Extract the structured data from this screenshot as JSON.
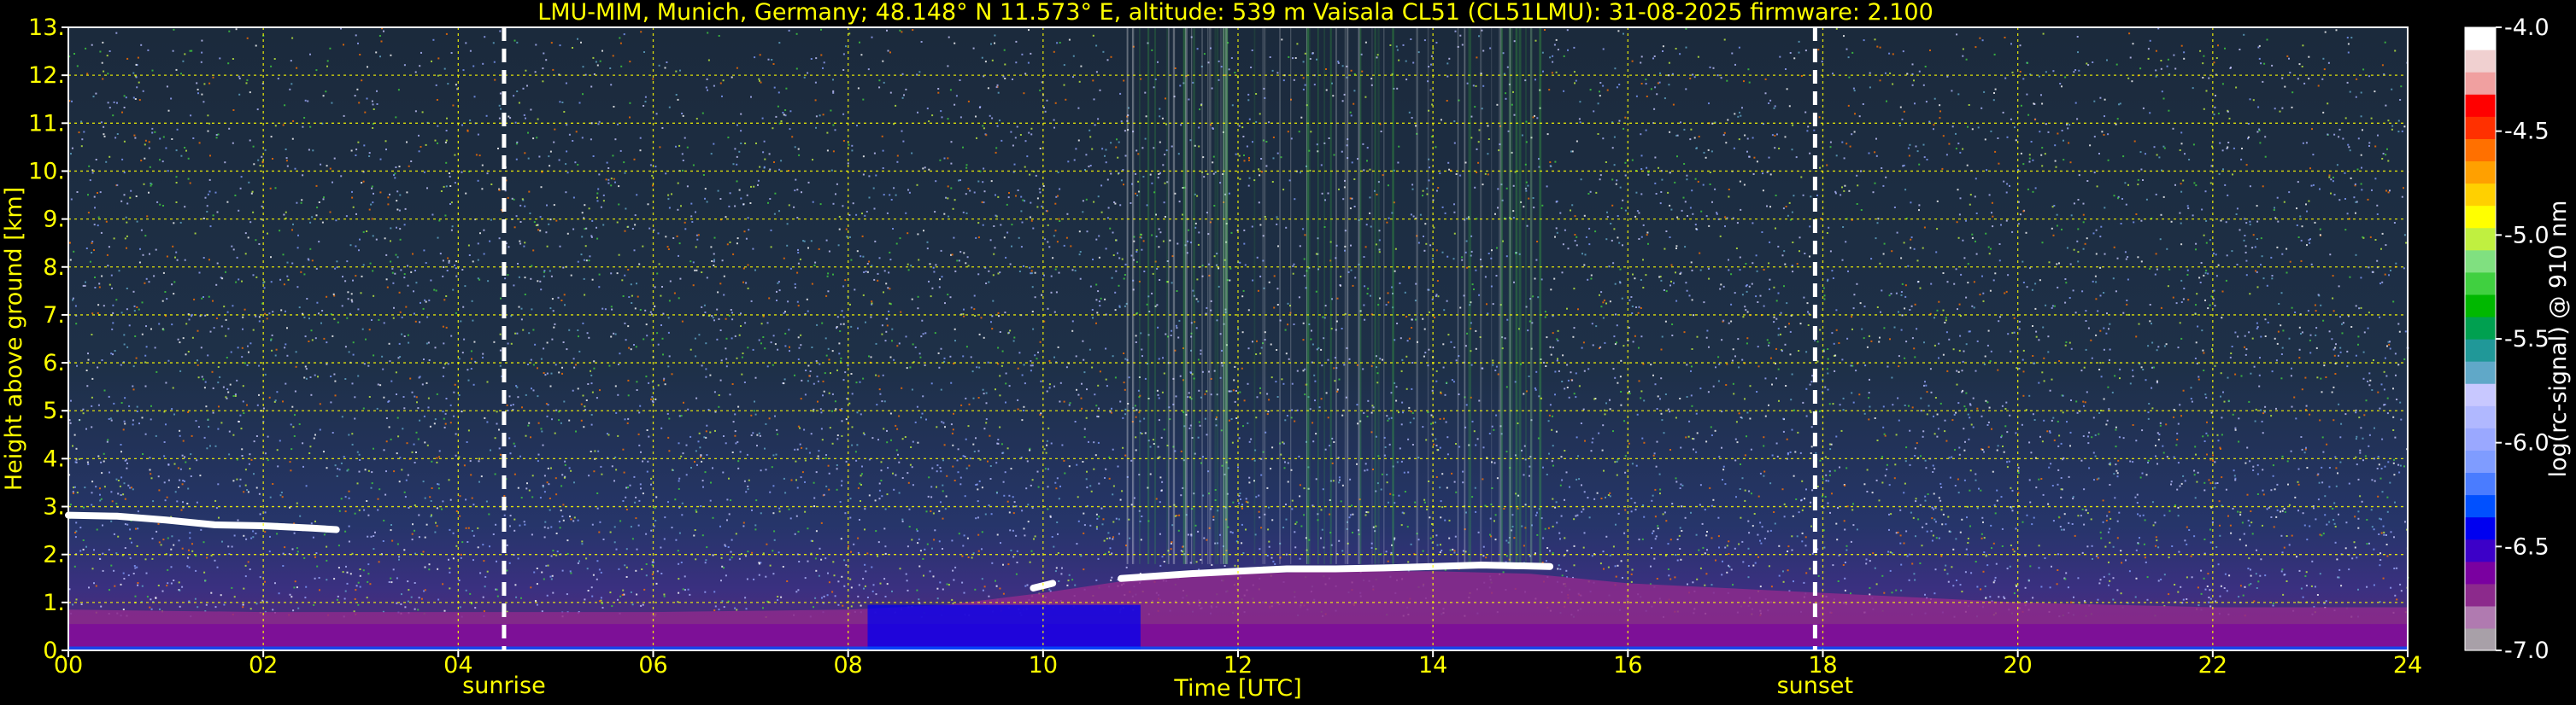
{
  "chart_data": {
    "type": "heatmap",
    "title": "LMU-MIM, Munich, Germany; 48.148° N 11.573° E, altitude: 539 m    Vaisala CL51 (CL51LMU): 31-08-2025    firmware: 2.100",
    "xlabel": "Time [UTC]",
    "ylabel": "Height above ground [km]",
    "xlim": [
      0,
      24
    ],
    "ylim": [
      0,
      13
    ],
    "x_ticks": [
      "00",
      "02",
      "04",
      "06",
      "08",
      "10",
      "12",
      "14",
      "16",
      "18",
      "20",
      "22",
      "24"
    ],
    "y_ticks": [
      "0.",
      "1.",
      "2.",
      "3.",
      "4.",
      "5.",
      "6.",
      "7.",
      "8.",
      "9.",
      "10.",
      "11.",
      "12.",
      "13."
    ],
    "grid": true,
    "colorbar": {
      "label": "log(rc-signal) @ 910 nm",
      "range": [
        -7.0,
        -4.0
      ],
      "ticks": [
        "-4.0",
        "-4.5",
        "-5.0",
        "-5.5",
        "-6.0",
        "-6.5",
        "-7.0"
      ],
      "colors": [
        "#a8a0a8",
        "#b07ab0",
        "#8c2a8c",
        "#7a00a0",
        "#3c00c8",
        "#0000f0",
        "#0050ff",
        "#4a7cff",
        "#7f9cff",
        "#9aa8ff",
        "#b0b8ff",
        "#c8c8ff",
        "#60a8c8",
        "#209898",
        "#00a050",
        "#00b800",
        "#40d040",
        "#80e080",
        "#c0f040",
        "#ffff00",
        "#ffd000",
        "#ffa000",
        "#ff7000",
        "#ff3000",
        "#ff0000",
        "#f0a0a0",
        "#f0d0d0",
        "#ffffff"
      ]
    },
    "events": [
      {
        "label": "sunrise",
        "time": 4.47
      },
      {
        "label": "sunset",
        "time": 17.92
      }
    ],
    "boundary_layer": {
      "series_name": "",
      "time": [
        0,
        2,
        4,
        6,
        8,
        9,
        10,
        11,
        12,
        13,
        14,
        15,
        16,
        18,
        20,
        22,
        24
      ],
      "height_km": [
        0.85,
        0.8,
        0.8,
        0.8,
        0.85,
        0.95,
        1.2,
        1.5,
        1.6,
        1.65,
        1.65,
        1.6,
        1.4,
        1.2,
        1.0,
        0.9,
        0.9
      ]
    },
    "cloud_layers": [
      {
        "name": "",
        "time": [
          0.0,
          0.5,
          1.0,
          1.5,
          2.0,
          2.5,
          2.75
        ],
        "height_km": [
          2.82,
          2.8,
          2.72,
          2.62,
          2.6,
          2.55,
          2.52
        ]
      },
      {
        "name": "",
        "time": [
          9.9,
          10.1
        ],
        "height_km": [
          1.3,
          1.4
        ]
      },
      {
        "name": "",
        "time": [
          10.8,
          11.5,
          12.0,
          12.5,
          13.0,
          13.5,
          14.0,
          14.5,
          15.2
        ],
        "height_km": [
          1.5,
          1.6,
          1.65,
          1.7,
          1.7,
          1.72,
          1.75,
          1.78,
          1.75
        ]
      }
    ]
  }
}
